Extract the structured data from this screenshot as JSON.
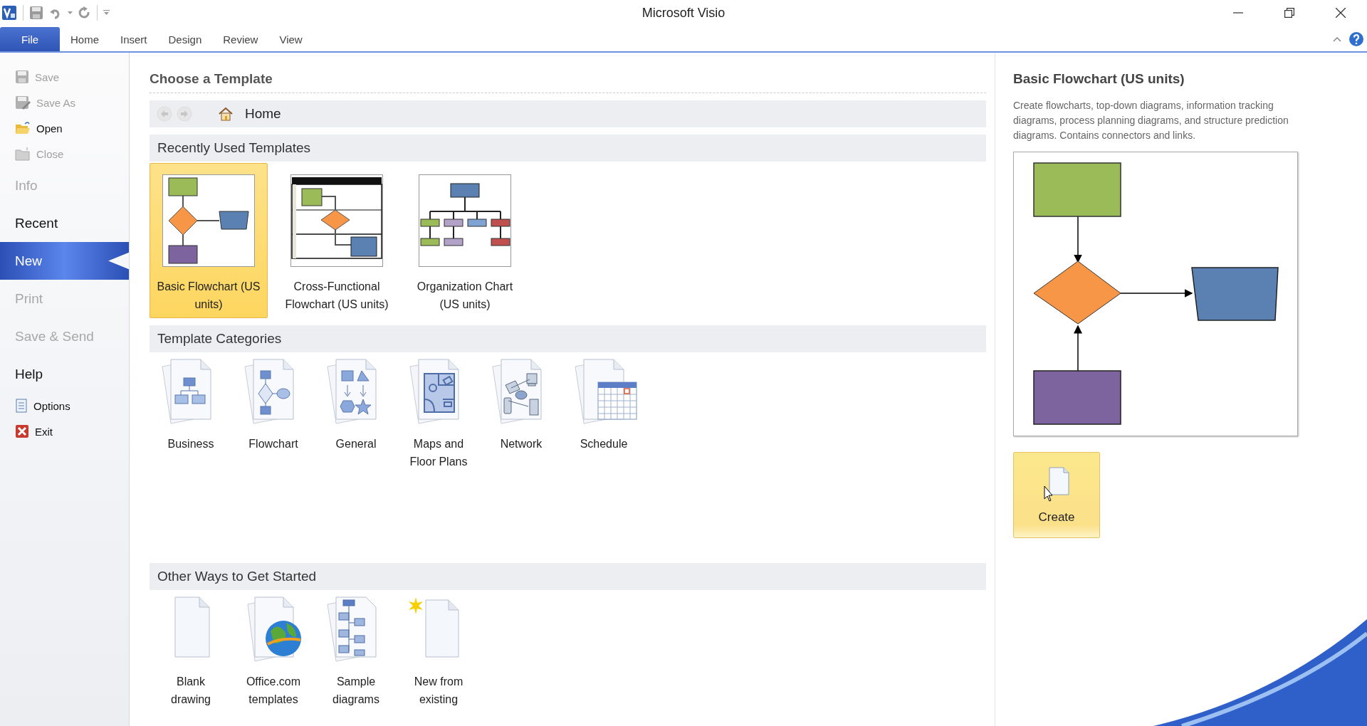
{
  "window": {
    "title": "Microsoft Visio"
  },
  "ribbon": {
    "tabs": [
      {
        "label": "File",
        "selected": true
      },
      {
        "label": "Home",
        "selected": false
      },
      {
        "label": "Insert",
        "selected": false
      },
      {
        "label": "Design",
        "selected": false
      },
      {
        "label": "Review",
        "selected": false
      },
      {
        "label": "View",
        "selected": false
      }
    ]
  },
  "sidebar": {
    "items": [
      {
        "kind": "command",
        "label": "Save",
        "disabled": true
      },
      {
        "kind": "command",
        "label": "Save As",
        "disabled": true
      },
      {
        "kind": "command",
        "label": "Open",
        "disabled": false
      },
      {
        "kind": "command",
        "label": "Close",
        "disabled": true
      },
      {
        "kind": "section",
        "label": "Info",
        "disabled": true,
        "selected": false
      },
      {
        "kind": "section",
        "label": "Recent",
        "disabled": false,
        "selected": false
      },
      {
        "kind": "section",
        "label": "New",
        "disabled": false,
        "selected": true
      },
      {
        "kind": "section",
        "label": "Print",
        "disabled": true,
        "selected": false
      },
      {
        "kind": "section",
        "label": "Save & Send",
        "disabled": true,
        "selected": false
      },
      {
        "kind": "section",
        "label": "Help",
        "disabled": false,
        "selected": false
      },
      {
        "kind": "command",
        "label": "Options",
        "disabled": false
      },
      {
        "kind": "command",
        "label": "Exit",
        "disabled": false
      }
    ]
  },
  "main": {
    "title": "Choose a Template",
    "breadcrumb": "Home",
    "recent": {
      "heading": "Recently Used Templates",
      "templates": [
        {
          "label": "Basic Flowchart (US units)",
          "selected": true
        },
        {
          "label": "Cross-Functional Flowchart (US units)",
          "selected": false
        },
        {
          "label": "Organization Chart (US units)",
          "selected": false
        }
      ]
    },
    "categories": {
      "heading": "Template Categories",
      "items": [
        "Business",
        "Flowchart",
        "General",
        "Maps and Floor Plans",
        "Network",
        "Schedule"
      ]
    },
    "other": {
      "heading": "Other Ways to Get Started",
      "items": [
        "Blank drawing",
        "Office.com templates",
        "Sample diagrams",
        "New from existing"
      ]
    }
  },
  "preview": {
    "title": "Basic Flowchart (US units)",
    "description": "Create flowcharts, top-down diagrams, information tracking diagrams, process planning diagrams, and structure prediction diagrams. Contains connectors and links.",
    "button": "Create"
  }
}
